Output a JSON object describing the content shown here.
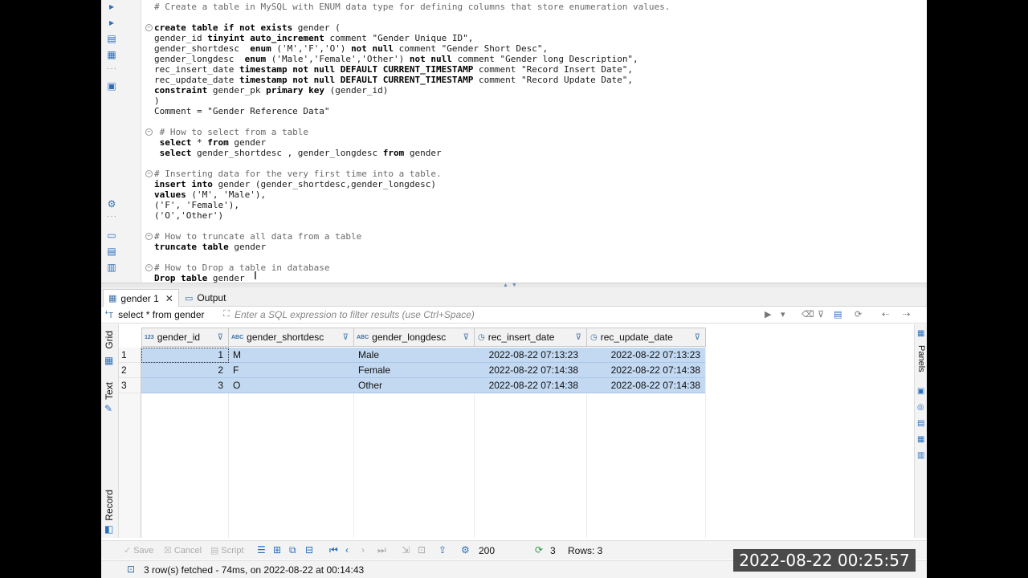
{
  "editor": {
    "lines": [
      {
        "fold": false,
        "parts": [
          {
            "t": "# Create a table in MySQL with ENUM data type for defining columns that store enumeration values.",
            "c": "cm"
          }
        ]
      },
      {
        "fold": true,
        "parts": [
          {
            "t": "create table if not exists",
            "c": "kw"
          },
          {
            "t": " gender (",
            "c": "st"
          }
        ]
      },
      {
        "fold": false,
        "parts": [
          {
            "t": "gender_id ",
            "c": "st"
          },
          {
            "t": "tinyint auto_increment",
            "c": "kw"
          },
          {
            "t": " comment \"Gender Unique ID\",",
            "c": "st"
          }
        ]
      },
      {
        "fold": false,
        "parts": [
          {
            "t": "gender_shortdesc  ",
            "c": "st"
          },
          {
            "t": "enum",
            "c": "kw"
          },
          {
            "t": " ('M','F','O') ",
            "c": "st"
          },
          {
            "t": "not null",
            "c": "kw"
          },
          {
            "t": " comment \"Gender Short Desc\",",
            "c": "st"
          }
        ]
      },
      {
        "fold": false,
        "parts": [
          {
            "t": "gender_longdesc  ",
            "c": "st"
          },
          {
            "t": "enum",
            "c": "kw"
          },
          {
            "t": " ('Male','Female','Other') ",
            "c": "st"
          },
          {
            "t": "not null",
            "c": "kw"
          },
          {
            "t": " comment \"Gender long Description\",",
            "c": "st"
          }
        ]
      },
      {
        "fold": false,
        "parts": [
          {
            "t": "rec_insert_date ",
            "c": "st"
          },
          {
            "t": "timestamp not null DEFAULT CURRENT_TIMESTAMP",
            "c": "kw"
          },
          {
            "t": " comment \"Record Insert Date\",",
            "c": "st"
          }
        ]
      },
      {
        "fold": false,
        "parts": [
          {
            "t": "rec_update_date ",
            "c": "st"
          },
          {
            "t": "timestamp not null DEFAULT CURRENT_TIMESTAMP",
            "c": "kw"
          },
          {
            "t": " comment \"Record Update Date\",",
            "c": "st"
          }
        ]
      },
      {
        "fold": false,
        "parts": [
          {
            "t": "constraint",
            "c": "kw"
          },
          {
            "t": " gender_pk ",
            "c": "st"
          },
          {
            "t": "primary key",
            "c": "kw"
          },
          {
            "t": " (gender_id)",
            "c": "st"
          }
        ]
      },
      {
        "fold": false,
        "parts": [
          {
            "t": ")",
            "c": "st"
          }
        ]
      },
      {
        "fold": false,
        "parts": [
          {
            "t": "Comment = \"Gender Reference Data\"",
            "c": "st"
          }
        ]
      },
      {
        "fold": true,
        "parts": [
          {
            "t": " # How to select from a table",
            "c": "cm"
          }
        ]
      },
      {
        "fold": false,
        "parts": [
          {
            "t": " select",
            "c": "kw"
          },
          {
            "t": " * ",
            "c": "st"
          },
          {
            "t": "from",
            "c": "kw"
          },
          {
            "t": " gender",
            "c": "st"
          }
        ]
      },
      {
        "fold": false,
        "parts": [
          {
            "t": " select",
            "c": "kw"
          },
          {
            "t": " gender_shortdesc , gender_longdesc ",
            "c": "st"
          },
          {
            "t": "from",
            "c": "kw"
          },
          {
            "t": " gender",
            "c": "st"
          }
        ]
      },
      {
        "fold": true,
        "parts": [
          {
            "t": "# Inserting data for the very first time into a table.",
            "c": "cm"
          }
        ]
      },
      {
        "fold": false,
        "parts": [
          {
            "t": "insert into",
            "c": "kw"
          },
          {
            "t": " gender (gender_shortdesc,gender_longdesc)",
            "c": "st"
          }
        ]
      },
      {
        "fold": false,
        "parts": [
          {
            "t": "values",
            "c": "kw"
          },
          {
            "t": " ('M', 'Male'),",
            "c": "st"
          }
        ]
      },
      {
        "fold": false,
        "parts": [
          {
            "t": "('F', 'Female'),",
            "c": "st"
          }
        ]
      },
      {
        "fold": false,
        "parts": [
          {
            "t": "('O','Other')",
            "c": "st"
          }
        ]
      },
      {
        "fold": true,
        "parts": [
          {
            "t": "# How to truncate all data from a table",
            "c": "cm"
          }
        ]
      },
      {
        "fold": false,
        "parts": [
          {
            "t": "truncate table",
            "c": "kw"
          },
          {
            "t": " gender",
            "c": "st"
          }
        ]
      },
      {
        "fold": true,
        "parts": [
          {
            "t": "# How to Drop a table in database",
            "c": "cm"
          }
        ]
      },
      {
        "fold": false,
        "parts": [
          {
            "t": "Drop table",
            "c": "kw"
          },
          {
            "t": " gender",
            "c": "st"
          }
        ]
      }
    ]
  },
  "tabs": {
    "results_label": "gender 1",
    "output_label": "Output"
  },
  "filter": {
    "query_label": "select * from gender",
    "placeholder": "Enter a SQL expression to filter results (use Ctrl+Space)"
  },
  "side_tabs": {
    "grid": "Grid",
    "text": "Text",
    "record": "Record",
    "panels": "Panels"
  },
  "grid": {
    "columns": [
      {
        "name": "gender_id",
        "type_tag": "123"
      },
      {
        "name": "gender_shortdesc",
        "type_tag": "ABC"
      },
      {
        "name": "gender_longdesc",
        "type_tag": "ABC"
      },
      {
        "name": "rec_insert_date",
        "type_tag": "clock"
      },
      {
        "name": "rec_update_date",
        "type_tag": "clock"
      }
    ],
    "rows": [
      {
        "num": "1",
        "cells": [
          "1",
          "M",
          "Male",
          "2022-08-22 07:13:23",
          "2022-08-22 07:13:23"
        ]
      },
      {
        "num": "2",
        "cells": [
          "2",
          "F",
          "Female",
          "2022-08-22 07:14:38",
          "2022-08-22 07:14:38"
        ]
      },
      {
        "num": "3",
        "cells": [
          "3",
          "O",
          "Other",
          "2022-08-22 07:14:38",
          "2022-08-22 07:14:38"
        ]
      }
    ]
  },
  "toolbar": {
    "save_label": "Save",
    "cancel_label": "Cancel",
    "script_label": "Script",
    "fetch_size": "200",
    "row_count": "3",
    "rows_label": "Rows: 3"
  },
  "status": {
    "text": "3 row(s) fetched - 74ms, on 2022-08-22 at 00:14:43"
  },
  "overlay": {
    "timestamp": "2022-08-22 00:25:57"
  },
  "colors": {
    "selection": "#c3d9f2",
    "accent": "#2a6fbf"
  }
}
